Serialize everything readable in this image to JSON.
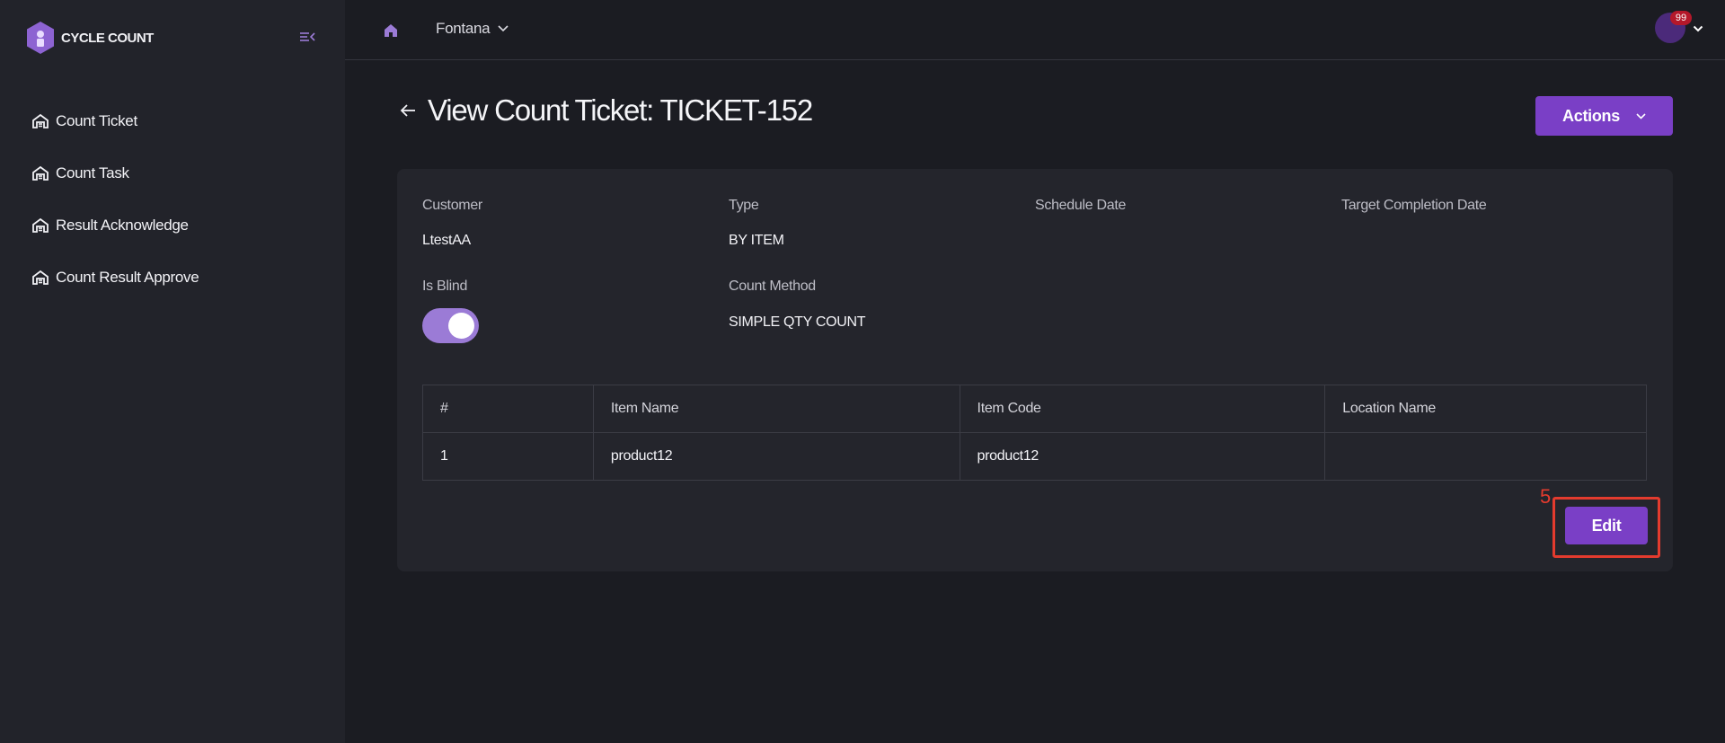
{
  "app": {
    "name": "CYCLE COUNT"
  },
  "sidebar": {
    "items": [
      {
        "label": "Count Ticket"
      },
      {
        "label": "Count Task"
      },
      {
        "label": "Result Acknowledge"
      },
      {
        "label": "Count Result Approve"
      }
    ]
  },
  "topbar": {
    "site": "Fontana",
    "notifications": "99"
  },
  "page": {
    "title": "View Count Ticket: TICKET-152",
    "actions_label": "Actions"
  },
  "details": {
    "customer_label": "Customer",
    "customer_value": "LtestAA",
    "type_label": "Type",
    "type_value": "BY ITEM",
    "schedule_label": "Schedule Date",
    "target_label": "Target Completion Date",
    "blind_label": "Is Blind",
    "blind_value": true,
    "method_label": "Count Method",
    "method_value": "SIMPLE QTY COUNT"
  },
  "table": {
    "headers": [
      "#",
      "Item Name",
      "Item Code",
      "Location Name"
    ],
    "rows": [
      [
        "1",
        "product12",
        "product12",
        ""
      ]
    ]
  },
  "edit_label": "Edit",
  "annotation": {
    "number": "5"
  },
  "colors": {
    "accent": "#7a3fc6",
    "sidebar_bg": "#22232a",
    "page_bg": "#1b1c22",
    "card_bg": "#24252c",
    "highlight": "#e33b2e"
  }
}
